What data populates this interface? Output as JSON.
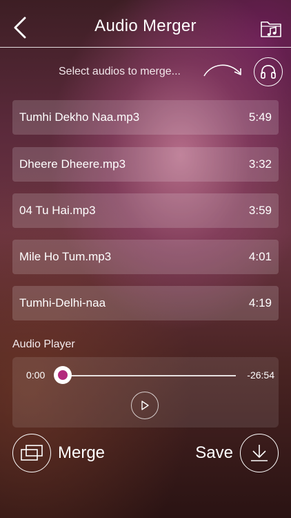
{
  "header": {
    "title": "Audio Merger",
    "back_icon": "chevron-left-icon",
    "folder_icon": "music-folder-icon"
  },
  "prompt": {
    "text": "Select audios to merge...",
    "headphone_icon": "headphone-icon"
  },
  "tracks": [
    {
      "name": "Tumhi Dekho Naa.mp3",
      "duration": "5:49"
    },
    {
      "name": "Dheere Dheere.mp3",
      "duration": "3:32"
    },
    {
      "name": "04 Tu Hai.mp3",
      "duration": "3:59"
    },
    {
      "name": "Mile Ho Tum.mp3",
      "duration": "4:01"
    },
    {
      "name": "Tumhi-Delhi-naa",
      "duration": "4:19"
    }
  ],
  "player": {
    "label": "Audio Player",
    "current_time": "0:00",
    "remaining_time": "-26:54",
    "progress": 0,
    "play_icon": "play-icon"
  },
  "actions": {
    "merge_label": "Merge",
    "save_label": "Save",
    "merge_icon": "merge-icon",
    "save_icon": "download-icon"
  },
  "colors": {
    "accent": "#b32a7d",
    "text": "#ffffff"
  }
}
